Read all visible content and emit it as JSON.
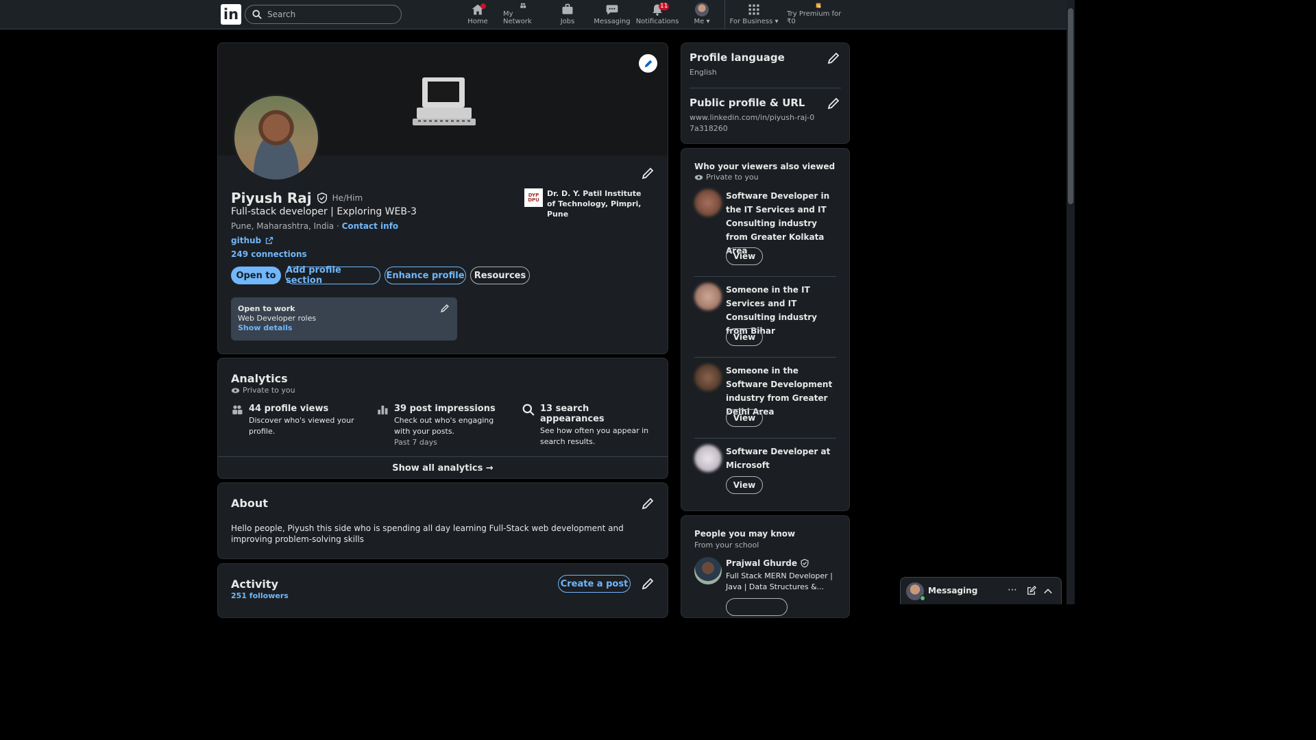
{
  "nav": {
    "logo": "in",
    "search_placeholder": "Search",
    "items": [
      {
        "label": "Home",
        "badge": ""
      },
      {
        "label": "My Network",
        "badge": ""
      },
      {
        "label": "Jobs",
        "badge": ""
      },
      {
        "label": "Messaging",
        "badge": ""
      },
      {
        "label": "Notifications",
        "badge": "11"
      },
      {
        "label": "Me",
        "badge": ""
      },
      {
        "label": "For Business",
        "badge": ""
      },
      {
        "label": "Try Premium for ₹0",
        "badge": ""
      }
    ]
  },
  "profile": {
    "name": "Piyush Raj",
    "pronouns": "He/Him",
    "headline": "Full-stack developer | Exploring WEB-3",
    "location": "Pune, Maharashtra, India",
    "location_sep": " · ",
    "contact_info": "Contact info",
    "website": "github",
    "connections": "249 connections",
    "school_logo_text": "DYP DPU",
    "school": "Dr. D. Y. Patil Institute of Technology, Pimpri, Pune",
    "buttons": {
      "open_to": "Open to",
      "add_section": "Add profile section",
      "enhance": "Enhance profile",
      "resources": "Resources"
    },
    "open_to_work": {
      "title": "Open to work",
      "roles": "Web Developer roles",
      "link": "Show details"
    }
  },
  "analytics": {
    "title": "Analytics",
    "privacy": "Private to you",
    "items": [
      {
        "title": "44 profile views",
        "desc": "Discover who's viewed your profile.",
        "extra": ""
      },
      {
        "title": "39 post impressions",
        "desc": "Check out who's engaging with your posts.",
        "extra": "Past 7 days"
      },
      {
        "title": "13 search appearances",
        "desc": "See how often you appear in search results.",
        "extra": ""
      }
    ],
    "show_all": "Show all analytics →"
  },
  "about": {
    "title": "About",
    "text": "Hello people, Piyush this side who is spending all day learning Full-Stack web development and improving problem-solving skills"
  },
  "activity": {
    "title": "Activity",
    "followers": "251 followers",
    "create_post": "Create a post"
  },
  "sidebar": {
    "language": {
      "title": "Profile language",
      "value": "English"
    },
    "public_url": {
      "title": "Public profile & URL",
      "value": "www.linkedin.com/in/piyush-raj-07a318260"
    },
    "viewers": {
      "title": "Who your viewers also viewed",
      "privacy": "Private to you",
      "view_label": "View",
      "items": [
        {
          "text": "Software Developer in the IT Services and IT Consulting industry from Greater Kolkata Area",
          "color": "#8a5a46"
        },
        {
          "text": "Someone in the IT Services and IT Consulting industry from Bihar",
          "color": "#b08878"
        },
        {
          "text": "Someone in the Software Development industry from Greater Delhi Area",
          "color": "#6e5040"
        },
        {
          "text": "Software Developer at Microsoft",
          "color": "#c8c0c8"
        }
      ]
    },
    "people": {
      "title": "People you may know",
      "subtitle": "From your school",
      "name": "Prajwal Ghurde",
      "headline": "Full Stack MERN Developer | Java | Data Structures &..."
    }
  },
  "messaging": {
    "label": "Messaging"
  },
  "colors": {
    "accent": "#71b7fb",
    "badge": "#cb112d",
    "card": "#1b1f23",
    "background": "#000000"
  }
}
